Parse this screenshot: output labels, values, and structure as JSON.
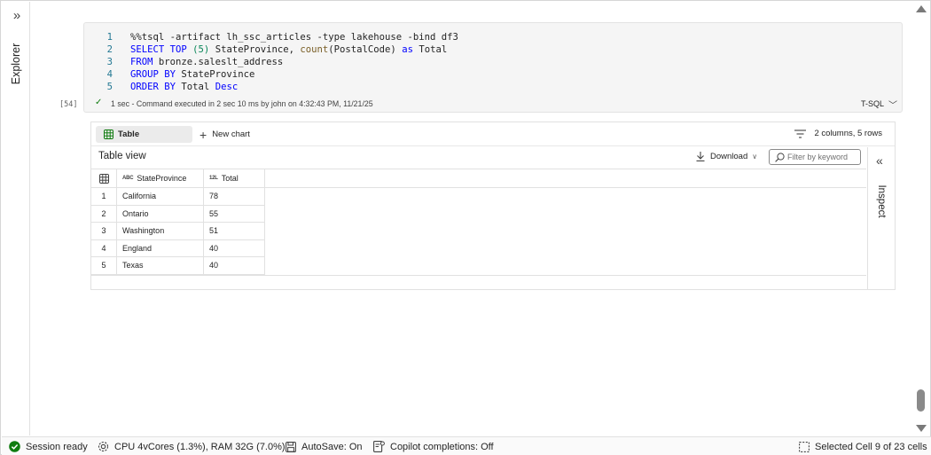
{
  "explorer": {
    "label": "Explorer",
    "expand_icon": "chevrons-right-icon"
  },
  "code_cell": {
    "execution_count": "[54]",
    "lines": [
      {
        "n": "1",
        "parts": [
          {
            "t": "%%tsql -artifact lh_ssc_articles -type lakehouse -bind df3",
            "c": "txt"
          }
        ]
      },
      {
        "n": "2",
        "parts": [
          {
            "t": "SELECT TOP ",
            "c": "kw"
          },
          {
            "t": "(5)",
            "c": "num"
          },
          {
            "t": " StateProvince, ",
            "c": "txt"
          },
          {
            "t": "count",
            "c": "fn"
          },
          {
            "t": "(PostalCode) ",
            "c": "txt"
          },
          {
            "t": "as",
            "c": "kw"
          },
          {
            "t": " Total",
            "c": "txt"
          }
        ]
      },
      {
        "n": "3",
        "parts": [
          {
            "t": "FROM",
            "c": "kw"
          },
          {
            "t": " bronze.saleslt_address",
            "c": "txt"
          }
        ]
      },
      {
        "n": "4",
        "parts": [
          {
            "t": "GROUP BY",
            "c": "kw"
          },
          {
            "t": " StateProvince",
            "c": "txt"
          }
        ]
      },
      {
        "n": "5",
        "parts": [
          {
            "t": "ORDER BY",
            "c": "kw"
          },
          {
            "t": " Total ",
            "c": "txt"
          },
          {
            "t": "Desc",
            "c": "kw"
          }
        ]
      }
    ],
    "status_text": "1 sec - Command executed in 2 sec 10 ms by john on 4:32:43 PM, 11/21/25",
    "language": "T-SQL"
  },
  "output": {
    "tab_table_label": "Table",
    "new_chart_label": "New chart",
    "summary": "2 columns, 5 rows",
    "table_view_title": "Table view",
    "download_label": "Download",
    "filter_placeholder": "Filter by keyword",
    "inspect_label": "Inspect",
    "columns": [
      {
        "type": "ABC",
        "name": "StateProvince"
      },
      {
        "type": "12L",
        "name": "Total"
      }
    ],
    "rows": [
      {
        "idx": "1",
        "state": "California",
        "total": "78"
      },
      {
        "idx": "2",
        "state": "Ontario",
        "total": "55"
      },
      {
        "idx": "3",
        "state": "Washington",
        "total": "51"
      },
      {
        "idx": "4",
        "state": "England",
        "total": "40"
      },
      {
        "idx": "5",
        "state": "Texas",
        "total": "40"
      }
    ]
  },
  "statusbar": {
    "session": "Session ready",
    "cpu": "CPU 4vCores (1.3%), RAM 32G (7.0%)",
    "autosave": "AutoSave: On",
    "copilot": "Copilot completions: Off",
    "selection": "Selected Cell 9 of 23 cells"
  },
  "colors": {
    "success": "#107c10",
    "keyword": "#0000ff",
    "function": "#795e26",
    "number": "#098658",
    "line_number": "#237893"
  }
}
